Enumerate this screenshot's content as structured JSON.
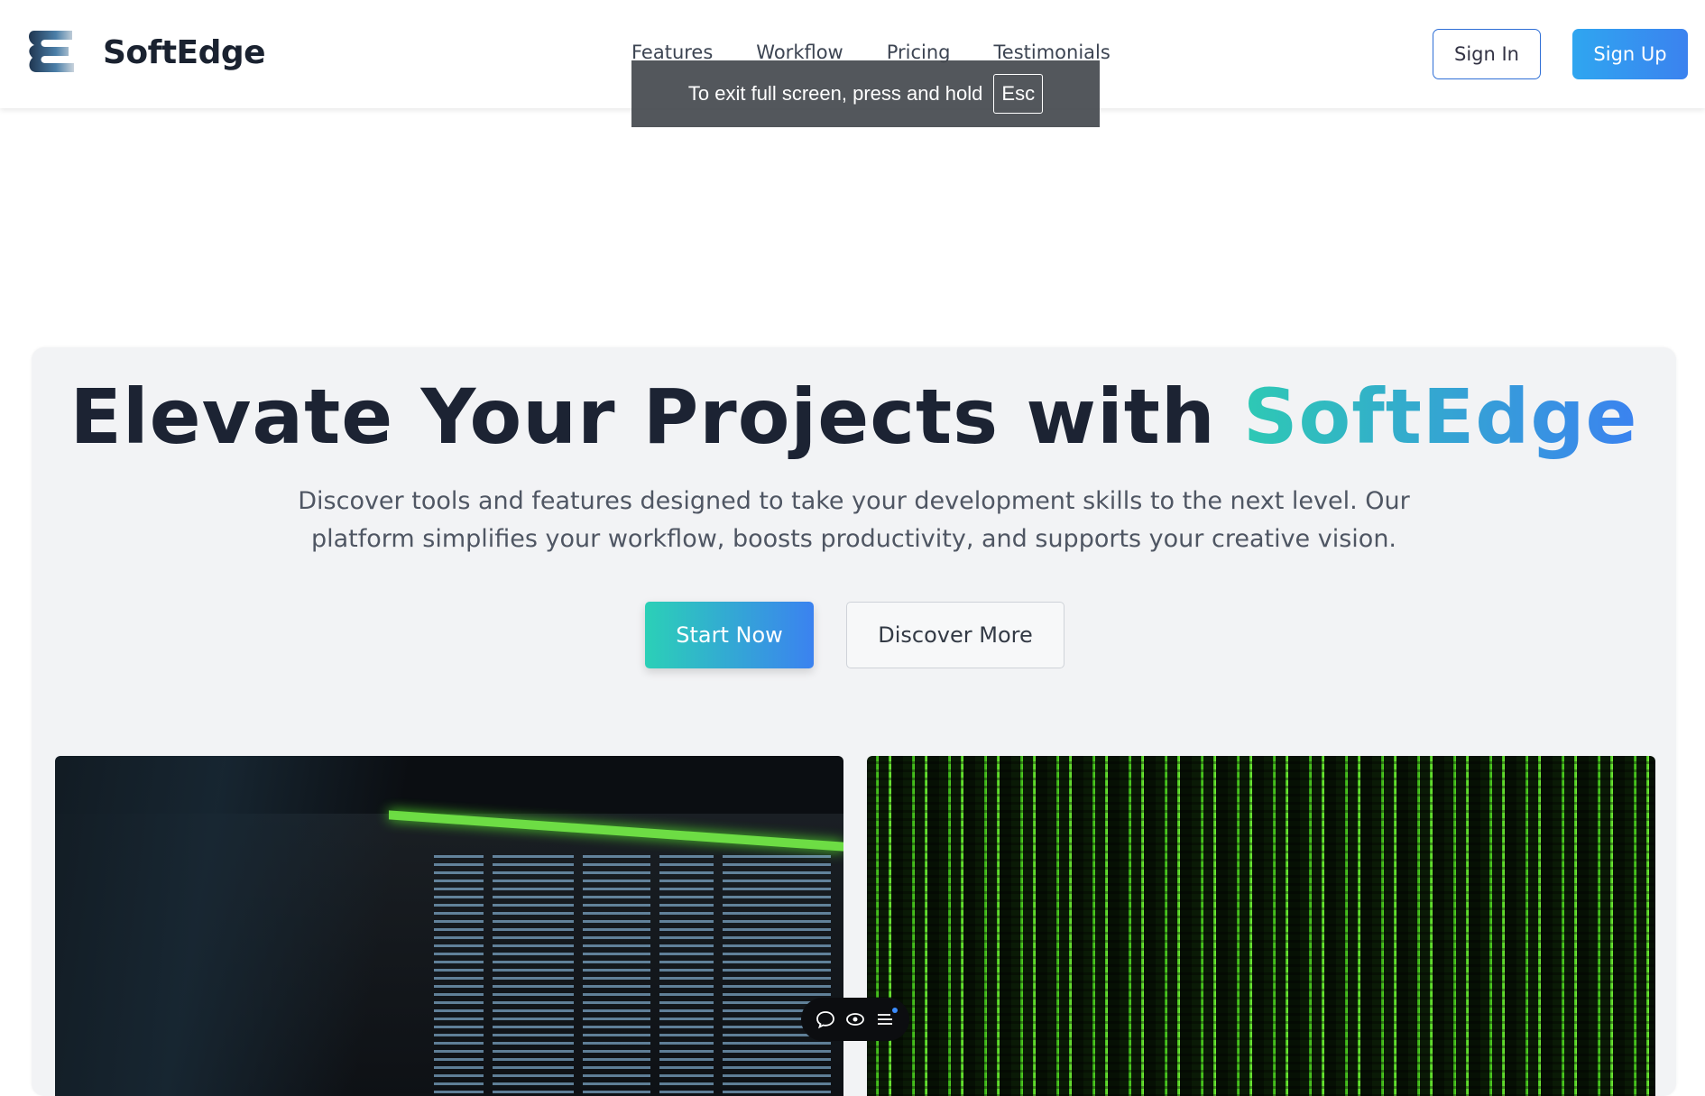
{
  "brand": {
    "name": "SoftEdge",
    "logo_icon": "softedge-logo-icon",
    "colors": {
      "accent_start": "#2ec9b4",
      "accent_end": "#3b82f0"
    }
  },
  "nav": {
    "items": [
      {
        "label": "Features"
      },
      {
        "label": "Workflow"
      },
      {
        "label": "Pricing"
      },
      {
        "label": "Testimonials"
      }
    ]
  },
  "auth": {
    "sign_in_label": "Sign In",
    "sign_up_label": "Sign Up"
  },
  "fullscreen_toast": {
    "text": "To exit full screen, press and hold",
    "key": "Esc"
  },
  "hero": {
    "title_prefix": "Elevate Your Projects with",
    "title_highlight": "SoftEdge",
    "subtitle": "Discover tools and features designed to take your development skills to the next level. Our platform simplifies your workflow, boosts productivity, and supports your creative vision.",
    "primary_cta": "Start Now",
    "secondary_cta": "Discover More"
  },
  "floating_toolbar": {
    "icons": [
      "chat-bubble-icon",
      "eye-icon",
      "menu-lines-icon"
    ]
  }
}
